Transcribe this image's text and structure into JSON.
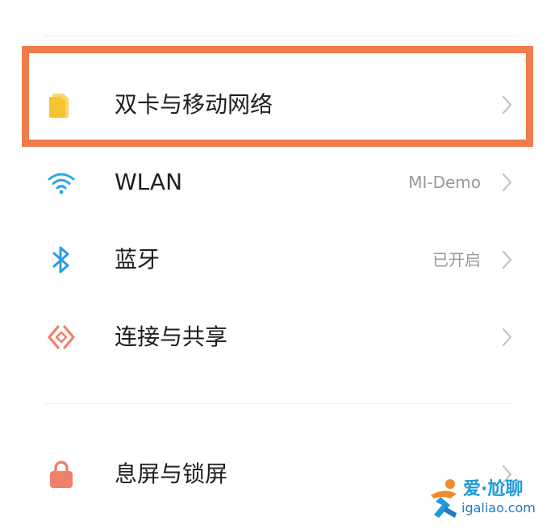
{
  "settings": {
    "items": [
      {
        "label": "双卡与移动网络",
        "value": "",
        "icon": "sim-card-icon"
      },
      {
        "label": "WLAN",
        "value": "MI-Demo",
        "icon": "wifi-icon"
      },
      {
        "label": "蓝牙",
        "value": "已开启",
        "icon": "bluetooth-icon"
      },
      {
        "label": "连接与共享",
        "value": "",
        "icon": "connection-share-icon"
      },
      {
        "label": "息屏与锁屏",
        "value": "",
        "icon": "lock-icon"
      }
    ]
  },
  "watermark": {
    "name": "爱·尬聊",
    "url": "igaliao.com"
  },
  "colors": {
    "highlight": "#f07c4c",
    "sim": "#f5c430",
    "wifi": "#27a8e0",
    "bluetooth": "#2a9ee0",
    "connection": "#f0806a",
    "lock": "#f0806a"
  }
}
